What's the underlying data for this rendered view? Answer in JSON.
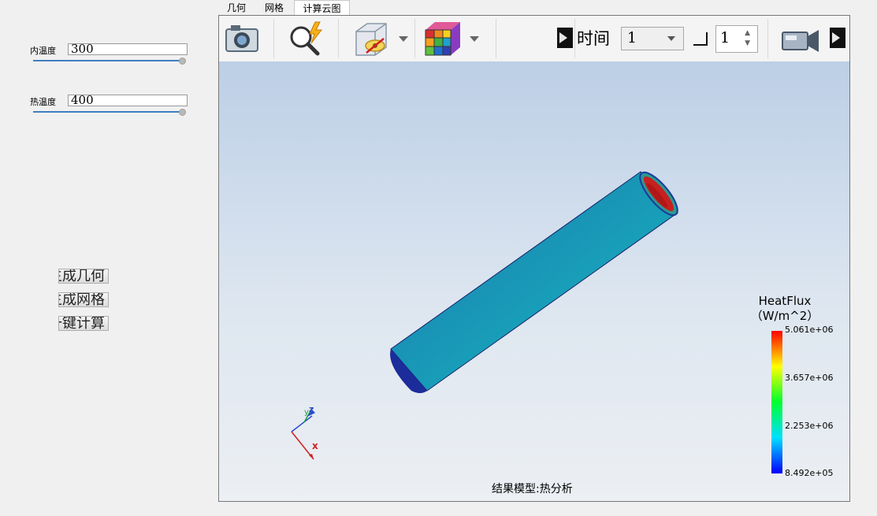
{
  "params": {
    "inner_temp": {
      "label": "内温度",
      "value": "300",
      "slider_fraction": 1.0
    },
    "hot_temp": {
      "label": "热温度",
      "value": "400",
      "slider_fraction": 1.0
    }
  },
  "actions": {
    "gen_geometry": "生成几何",
    "gen_mesh": "生成网格",
    "one_click_calc": "一键计算"
  },
  "tabs": [
    "几何",
    "网格",
    "计算云图"
  ],
  "active_tab": 2,
  "toolbar": {
    "icons": [
      "camera-icon",
      "magnifier-lightning-icon",
      "cube-visibility-icon",
      "color-cube-icon",
      "play-icon",
      "video-camera-icon"
    ],
    "time_label": "时间",
    "time_value": "1",
    "step_value": "1"
  },
  "legend": {
    "title": "HeatFlux",
    "unit": "（W/m^2）",
    "ticks": [
      "5.061e+06",
      "3.657e+06",
      "2.253e+06",
      "8.492e+05"
    ]
  },
  "axes": {
    "x": "x",
    "y": "y",
    "z": "z"
  },
  "status": "结果模型:热分析",
  "colors": {
    "accent": "#3f7fc0",
    "pipe_body": "#1a8fb0",
    "pipe_hot_end": "#c82020"
  }
}
